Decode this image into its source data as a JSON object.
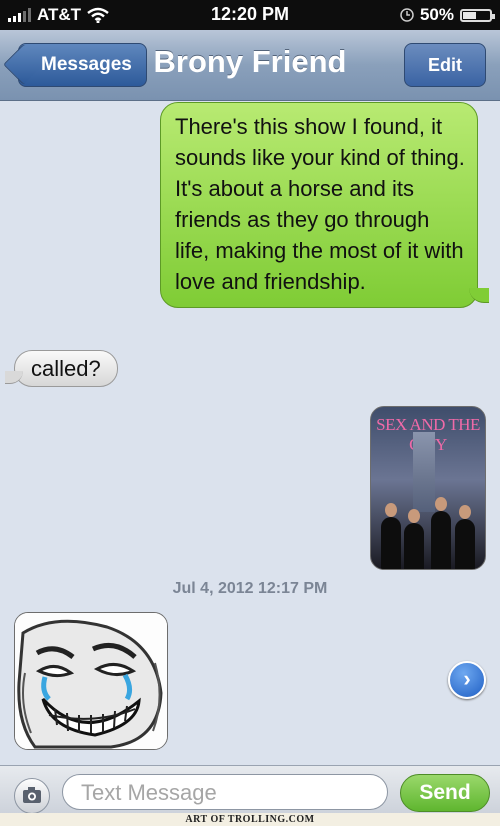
{
  "status_bar": {
    "carrier": "AT&T",
    "time": "12:20 PM",
    "battery": "50%",
    "battery_level": 0.5
  },
  "nav": {
    "back_label": "Messages",
    "title": "Brony Friend",
    "edit_label": "Edit"
  },
  "messages": [
    {
      "side": "sent",
      "text": "There's this show I found, it sounds like your kind of thing. It's about a horse and its friends as they go through life, making the most of it with love and friendship."
    },
    {
      "side": "received",
      "text": "called?"
    },
    {
      "side": "sent",
      "type": "image",
      "logo_text": "SEX AND THE CITY"
    },
    {
      "type": "timestamp",
      "text": "Jul 4, 2012 12:17 PM"
    },
    {
      "side": "received",
      "type": "image"
    }
  ],
  "input": {
    "placeholder": "Text Message",
    "send_label": "Send"
  },
  "watermark": "ART OF TROLLING.COM",
  "colors": {
    "sent_bubble": "#8fd44a",
    "received_bubble": "#e6e6e6",
    "nav_bar": "#8aa0bb",
    "background": "#dbe2ed"
  },
  "icons": [
    "wifi-icon",
    "signal-bars-icon",
    "clock-icon",
    "battery-icon",
    "camera-icon",
    "forward-arrow-icon"
  ]
}
